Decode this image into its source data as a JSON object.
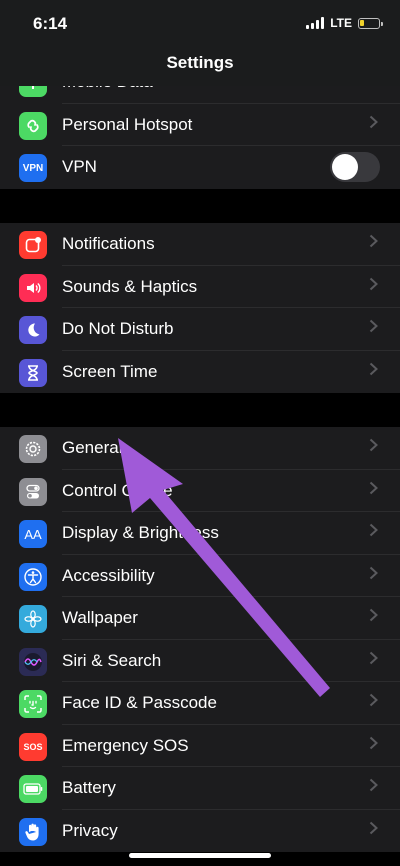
{
  "status": {
    "time": "6:14",
    "network": "LTE",
    "battery_level": 0.25,
    "battery_color": "#f1d22b"
  },
  "nav": {
    "title": "Settings"
  },
  "groups": [
    {
      "items": [
        {
          "label": "Mobile Data",
          "icon": "antenna-icon",
          "color": "#4cd964"
        },
        {
          "label": "Personal Hotspot",
          "icon": "hotspot-link-icon",
          "color": "#4cd964"
        },
        {
          "label": "VPN",
          "icon": "vpn-icon",
          "icon_text": "VPN",
          "color": "#1f6ff0",
          "toggle": false
        }
      ]
    },
    {
      "items": [
        {
          "label": "Notifications",
          "icon": "notifications-icon",
          "color": "#ff3b30"
        },
        {
          "label": "Sounds & Haptics",
          "icon": "speaker-icon",
          "color": "#ff2d55"
        },
        {
          "label": "Do Not Disturb",
          "icon": "moon-icon",
          "color": "#5856d6"
        },
        {
          "label": "Screen Time",
          "icon": "hourglass-icon",
          "color": "#5856d6"
        }
      ]
    },
    {
      "items": [
        {
          "label": "General",
          "icon": "gear-icon",
          "color": "#8e8e93"
        },
        {
          "label": "Control Centre",
          "icon": "switches-icon",
          "color": "#8e8e93"
        },
        {
          "label": "Display & Brightness",
          "icon": "text-size-icon",
          "icon_text": "AA",
          "color": "#1f6ff0"
        },
        {
          "label": "Accessibility",
          "icon": "accessibility-icon",
          "color": "#1f6ff0"
        },
        {
          "label": "Wallpaper",
          "icon": "flower-icon",
          "color": "#34aadc"
        },
        {
          "label": "Siri & Search",
          "icon": "siri-icon",
          "color": "#2b2b55"
        },
        {
          "label": "Face ID & Passcode",
          "icon": "face-id-icon",
          "color": "#4cd964"
        },
        {
          "label": "Emergency SOS",
          "icon": "sos-icon",
          "icon_text": "SOS",
          "color": "#ff3b30"
        },
        {
          "label": "Battery",
          "icon": "battery-icon",
          "color": "#4cd964"
        },
        {
          "label": "Privacy",
          "icon": "hand-icon",
          "color": "#1f6ff0"
        }
      ]
    }
  ],
  "annotation": {
    "arrow_color": "#a05ad8",
    "points_to": "General"
  }
}
